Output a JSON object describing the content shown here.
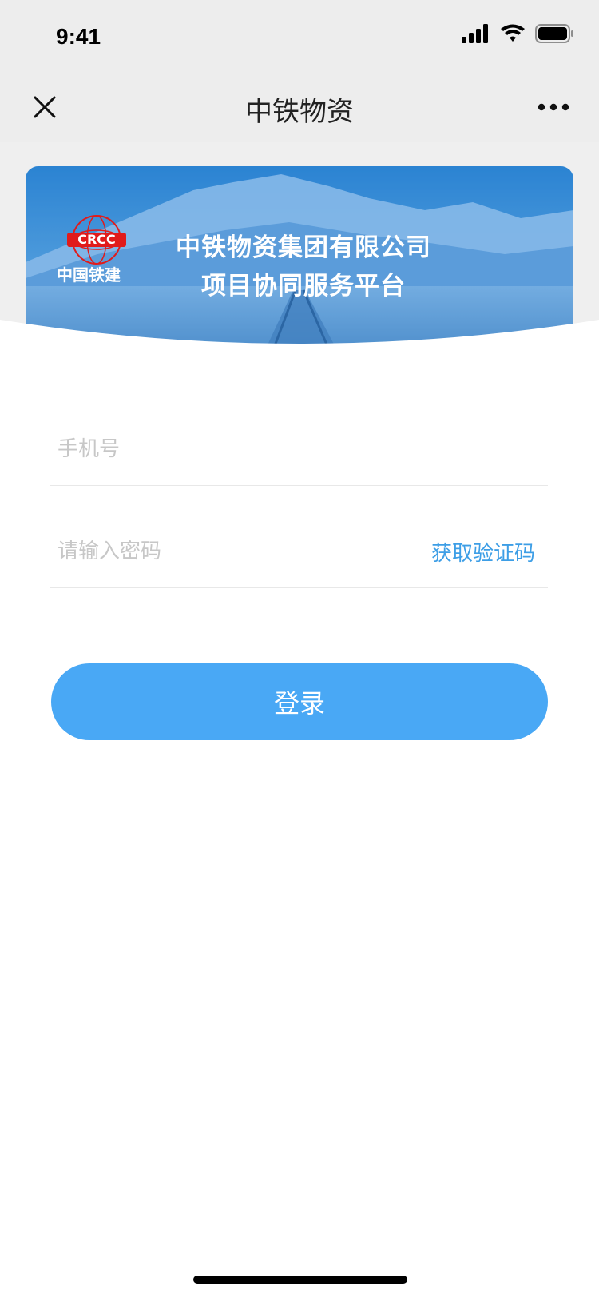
{
  "status_bar": {
    "time": "9:41"
  },
  "nav": {
    "title": "中铁物资",
    "close_icon": "close-icon",
    "more_icon": "more-icon"
  },
  "banner": {
    "logo_text": "中国铁建",
    "line1": "中铁物资集团有限公司",
    "line2": "项目协同服务平台"
  },
  "form": {
    "phone_placeholder": "手机号",
    "password_placeholder": "请输入密码",
    "get_code_label": "获取验证码",
    "login_label": "登录"
  },
  "colors": {
    "accent": "#49a8f5",
    "link": "#3d9ee6",
    "header_bg": "#ededed"
  }
}
